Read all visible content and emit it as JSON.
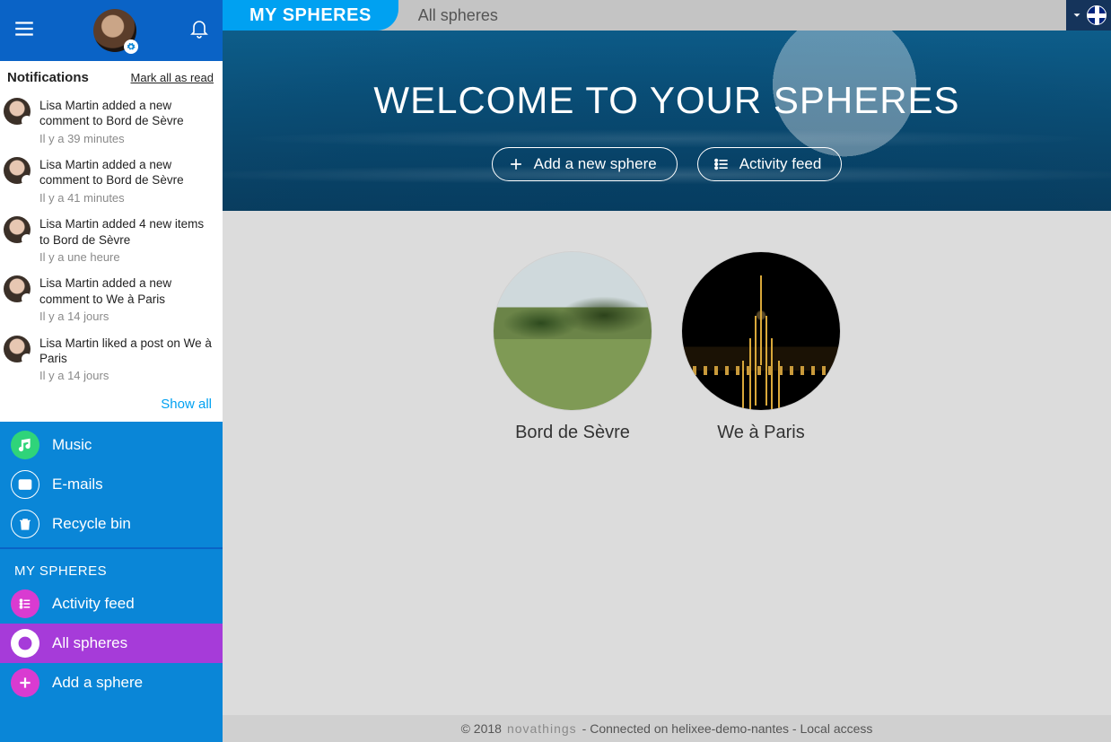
{
  "header": {
    "primary_tab": "MY SPHERES",
    "breadcrumb": "All spheres",
    "lang_code": "en-GB"
  },
  "hero": {
    "title": "WELCOME TO YOUR SPHERES",
    "add_label": "Add a new sphere",
    "activity_label": "Activity feed"
  },
  "spheres": [
    {
      "name": "Bord de Sèvre"
    },
    {
      "name": "We à Paris"
    }
  ],
  "footer": {
    "copyright": "© 2018",
    "brand": "novathings",
    "status": "- Connected on helixee-demo-nantes - Local access"
  },
  "notifications": {
    "title": "Notifications",
    "mark_all": "Mark all as read",
    "show_all": "Show all",
    "items": [
      {
        "text": "Lisa Martin added a new comment to Bord de Sèvre",
        "time": "Il y a 39 minutes"
      },
      {
        "text": "Lisa Martin added a new comment to Bord de Sèvre",
        "time": "Il y a 41 minutes"
      },
      {
        "text": "Lisa Martin added 4 new items to Bord de Sèvre",
        "time": "Il y a une heure"
      },
      {
        "text": "Lisa Martin added a new comment to We à Paris",
        "time": "Il y a 14 jours"
      },
      {
        "text": "Lisa Martin liked a post on We à Paris",
        "time": "Il y a 14 jours"
      }
    ]
  },
  "sidebar": {
    "top_menu": [
      {
        "icon": "music",
        "label": "Music"
      },
      {
        "icon": "mail",
        "label": "E-mails"
      },
      {
        "icon": "trash",
        "label": "Recycle bin"
      }
    ],
    "section_title": "MY SPHERES",
    "sphere_menu": [
      {
        "icon": "activity",
        "label": "Activity feed",
        "active": false
      },
      {
        "icon": "globe",
        "label": "All spheres",
        "active": true
      },
      {
        "icon": "plus",
        "label": "Add a sphere",
        "active": false
      }
    ]
  }
}
